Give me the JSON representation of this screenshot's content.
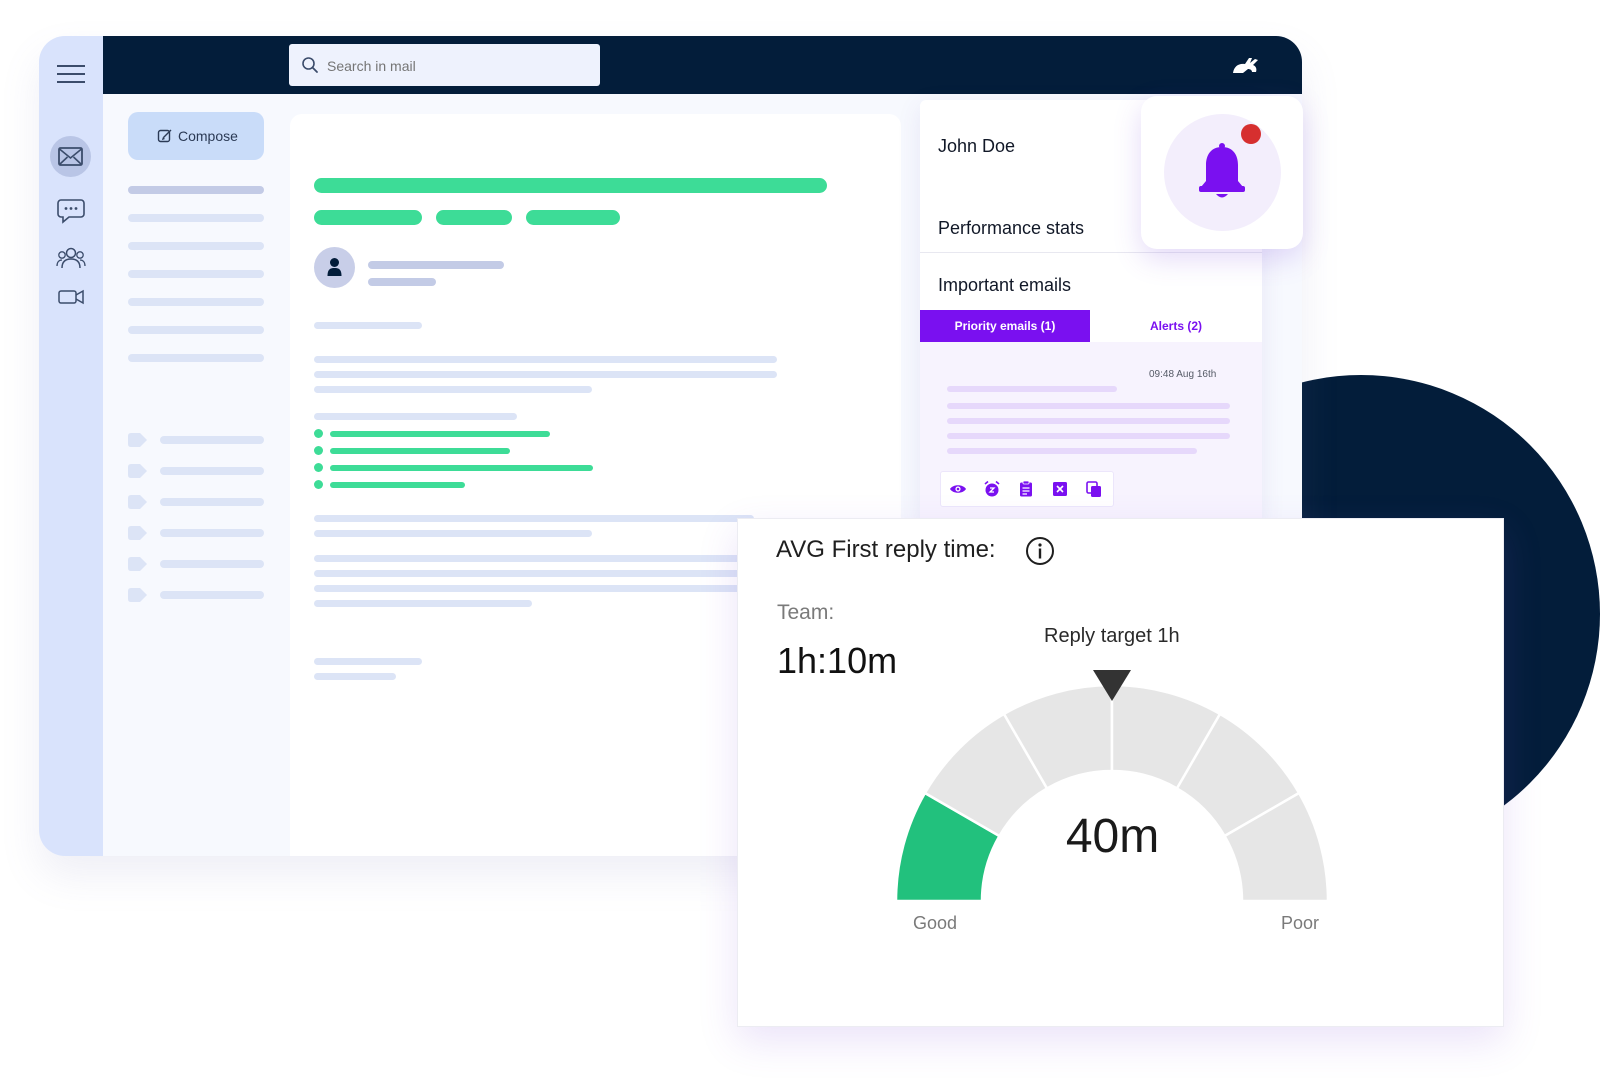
{
  "header": {
    "search": {
      "placeholder": "Search in mail"
    }
  },
  "sidebar": {
    "compose_label": "Compose"
  },
  "profile": {
    "name": "John Doe",
    "performance_label": "Performance stats",
    "important_label": "Important emails",
    "tabs": [
      {
        "label": "Priority emails (1)",
        "active": true
      },
      {
        "label": "Alerts (2)",
        "active": false
      }
    ],
    "email": {
      "time": "09:48 Aug 16th"
    },
    "actions": [
      "eye-icon",
      "alarm-icon",
      "clipboard-icon",
      "close-box-icon",
      "copy-icon"
    ]
  },
  "stats": {
    "title": "AVG First reply time:",
    "team_label": "Team:",
    "team_value": "1h:10m",
    "target_label": "Reply target 1h",
    "gauge": {
      "value_label": "40m",
      "value_minutes": 40,
      "segments": 6,
      "filled_segments": 1,
      "fill_color": "#22c17d",
      "empty_color": "#e6e6e6",
      "low_label": "Good",
      "high_label": "Poor"
    }
  },
  "colors": {
    "navy": "#031d3a",
    "accent_purple": "#7a10f0",
    "green": "#3ddc97",
    "sidebar": "#d9e3fc",
    "notification_dot": "#d62f2f"
  }
}
